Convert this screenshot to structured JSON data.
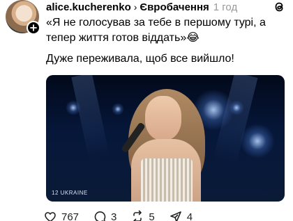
{
  "post": {
    "username": "alice.kucherenko",
    "topic": "Євробачення",
    "time": "1 год",
    "text_line1": "«Я не голосував за тебе в першому турі, а тепер життя готов віддать»😂",
    "text_line2": "Дуже переживала, щоб все вийшло!"
  },
  "video": {
    "caption": "12 UKRAINE"
  },
  "actions": {
    "likes": "767",
    "comments": "3",
    "reposts": "5",
    "shares": "4"
  },
  "icons": {
    "follow": "plus-icon",
    "app": "threads-icon",
    "like": "heart-icon",
    "comment": "comment-icon",
    "repost": "repost-icon",
    "share": "send-icon"
  }
}
